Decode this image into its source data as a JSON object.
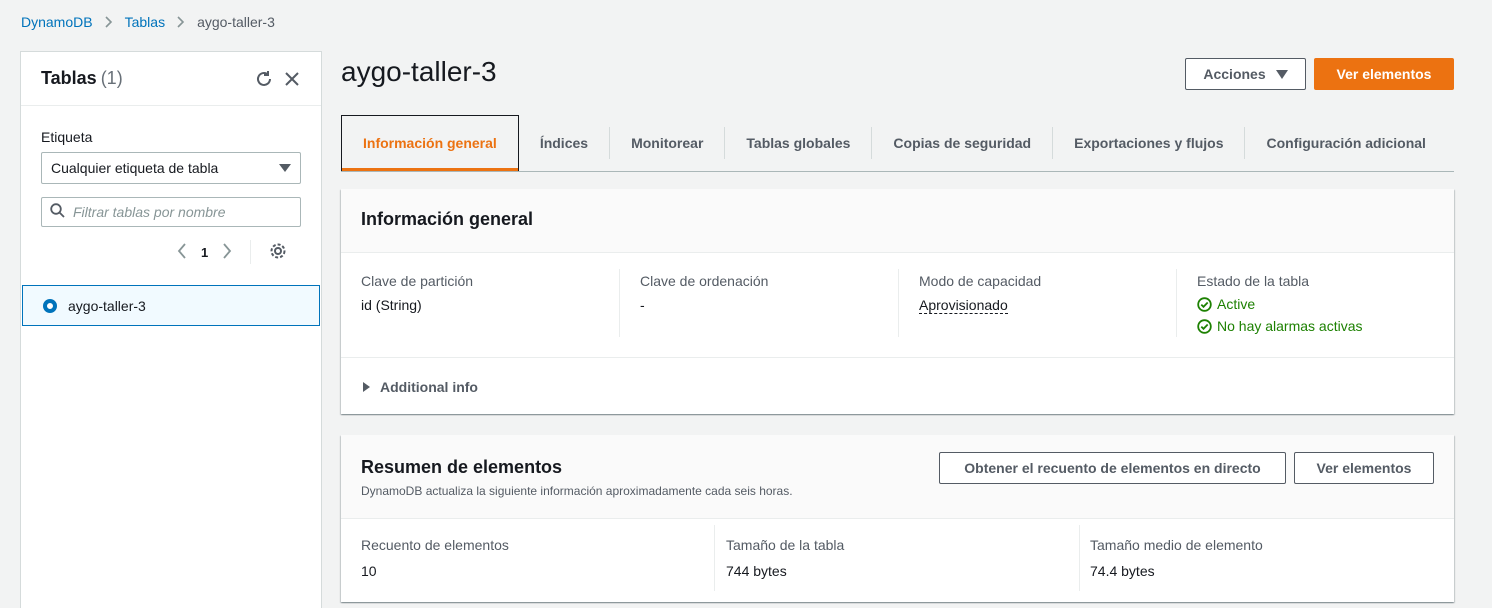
{
  "breadcrumb": {
    "root": "DynamoDB",
    "tables": "Tablas",
    "current": "aygo-taller-3"
  },
  "sidebar": {
    "title": "Tablas",
    "count": "(1)",
    "tag_label": "Etiqueta",
    "tag_select": "Cualquier etiqueta de tabla",
    "filter_placeholder": "Filtrar tablas por nombre",
    "page": "1",
    "tables": [
      {
        "name": "aygo-taller-3",
        "selected": true
      }
    ]
  },
  "header": {
    "title": "aygo-taller-3",
    "actions_label": "Acciones",
    "view_items_label": "Ver elementos"
  },
  "tabs": [
    {
      "label": "Información general",
      "active": true
    },
    {
      "label": "Índices"
    },
    {
      "label": "Monitorear"
    },
    {
      "label": "Tablas globales"
    },
    {
      "label": "Copias de seguridad"
    },
    {
      "label": "Exportaciones y flujos"
    },
    {
      "label": "Configuración adicional"
    }
  ],
  "general": {
    "title": "Información general",
    "partition_key_label": "Clave de partición",
    "partition_key_value": "id (String)",
    "sort_key_label": "Clave de ordenación",
    "sort_key_value": "-",
    "capacity_label": "Modo de capacidad",
    "capacity_value": "Aprovisionado",
    "status_label": "Estado de la tabla",
    "status_value": "Active",
    "alarms_value": "No hay alarmas activas",
    "additional_info": "Additional info"
  },
  "summary": {
    "title": "Resumen de elementos",
    "subtitle": "DynamoDB actualiza la siguiente información aproximadamente cada seis horas.",
    "live_count_label": "Obtener el recuento de elementos en directo",
    "view_items_label": "Ver elementos",
    "count_label": "Recuento de elementos",
    "count_value": "10",
    "size_label": "Tamaño de la tabla",
    "size_value": "744 bytes",
    "avg_label": "Tamaño medio de elemento",
    "avg_value": "74.4 bytes"
  },
  "colors": {
    "accent": "#ec7211",
    "link": "#0073bb",
    "success": "#1d8102"
  }
}
